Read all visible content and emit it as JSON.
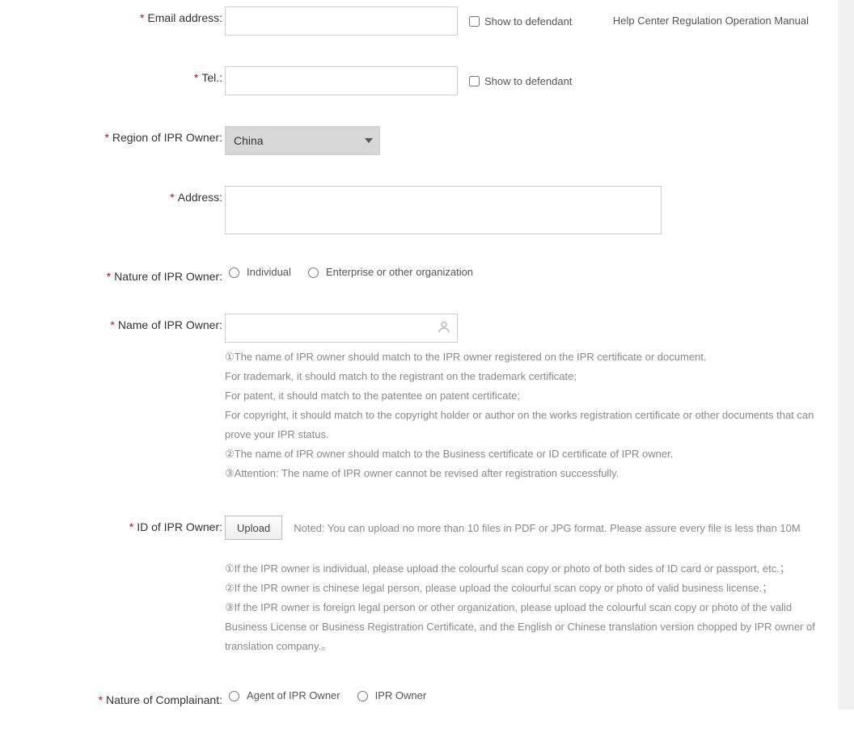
{
  "topLinks": {
    "helpCenter": "Help Center",
    "regulation": "Regulation",
    "operationManual": "Operation Manual"
  },
  "labels": {
    "email": "Email address:",
    "tel": "Tel.:",
    "region": "Region of IPR Owner:",
    "address": "Address:",
    "nature": "Nature of IPR Owner:",
    "name": "Name of IPR Owner:",
    "id": "ID of IPR Owner:",
    "natureComplainant": "Nature of Complainant:"
  },
  "fields": {
    "email": "",
    "tel": "",
    "regionSelected": "China",
    "address": "",
    "name": ""
  },
  "checkbox": {
    "showToDefendant": "Show to defendant"
  },
  "natureOptions": {
    "individual": "Individual",
    "enterprise": "Enterprise or other organization"
  },
  "complainantOptions": {
    "agent": "Agent of IPR Owner",
    "owner": "IPR Owner"
  },
  "upload": {
    "button": "Upload",
    "note": "Noted: You can upload no more than 10 files in PDF or JPG format. Please assure every file is less than 10M"
  },
  "nameHints": {
    "l1": "①The name of IPR owner should match to the IPR owner registered on the IPR certificate or document.",
    "l2": "For trademark, it should match to the registrant on the trademark certificate;",
    "l3": "For patent, it should match to the patentee on patent certificate;",
    "l4": "For copyright, it should match to the copyright holder or author on the works registration certificate or other documents that can prove your IPR status.",
    "l5": "②The name of IPR owner should match to the Business certificate or ID certificate of IPR owner.",
    "l6": "③Attention: The name of IPR owner cannot be revised after registration successfully."
  },
  "idHints": {
    "l1": "①If the IPR owner is individual, please upload the colourful scan copy or photo of both sides of ID card or passport, etc.；",
    "l2": "②If the IPR owner is chinese legal person, please upload the colourful scan copy or photo of valid business license.；",
    "l3": "③If the IPR owner is foreign legal person or other organization, please upload the colourful scan copy or photo of the valid Business License or Business Registration Certificate, and the English or Chinese translation version chopped by IPR owner of translation company.。"
  }
}
